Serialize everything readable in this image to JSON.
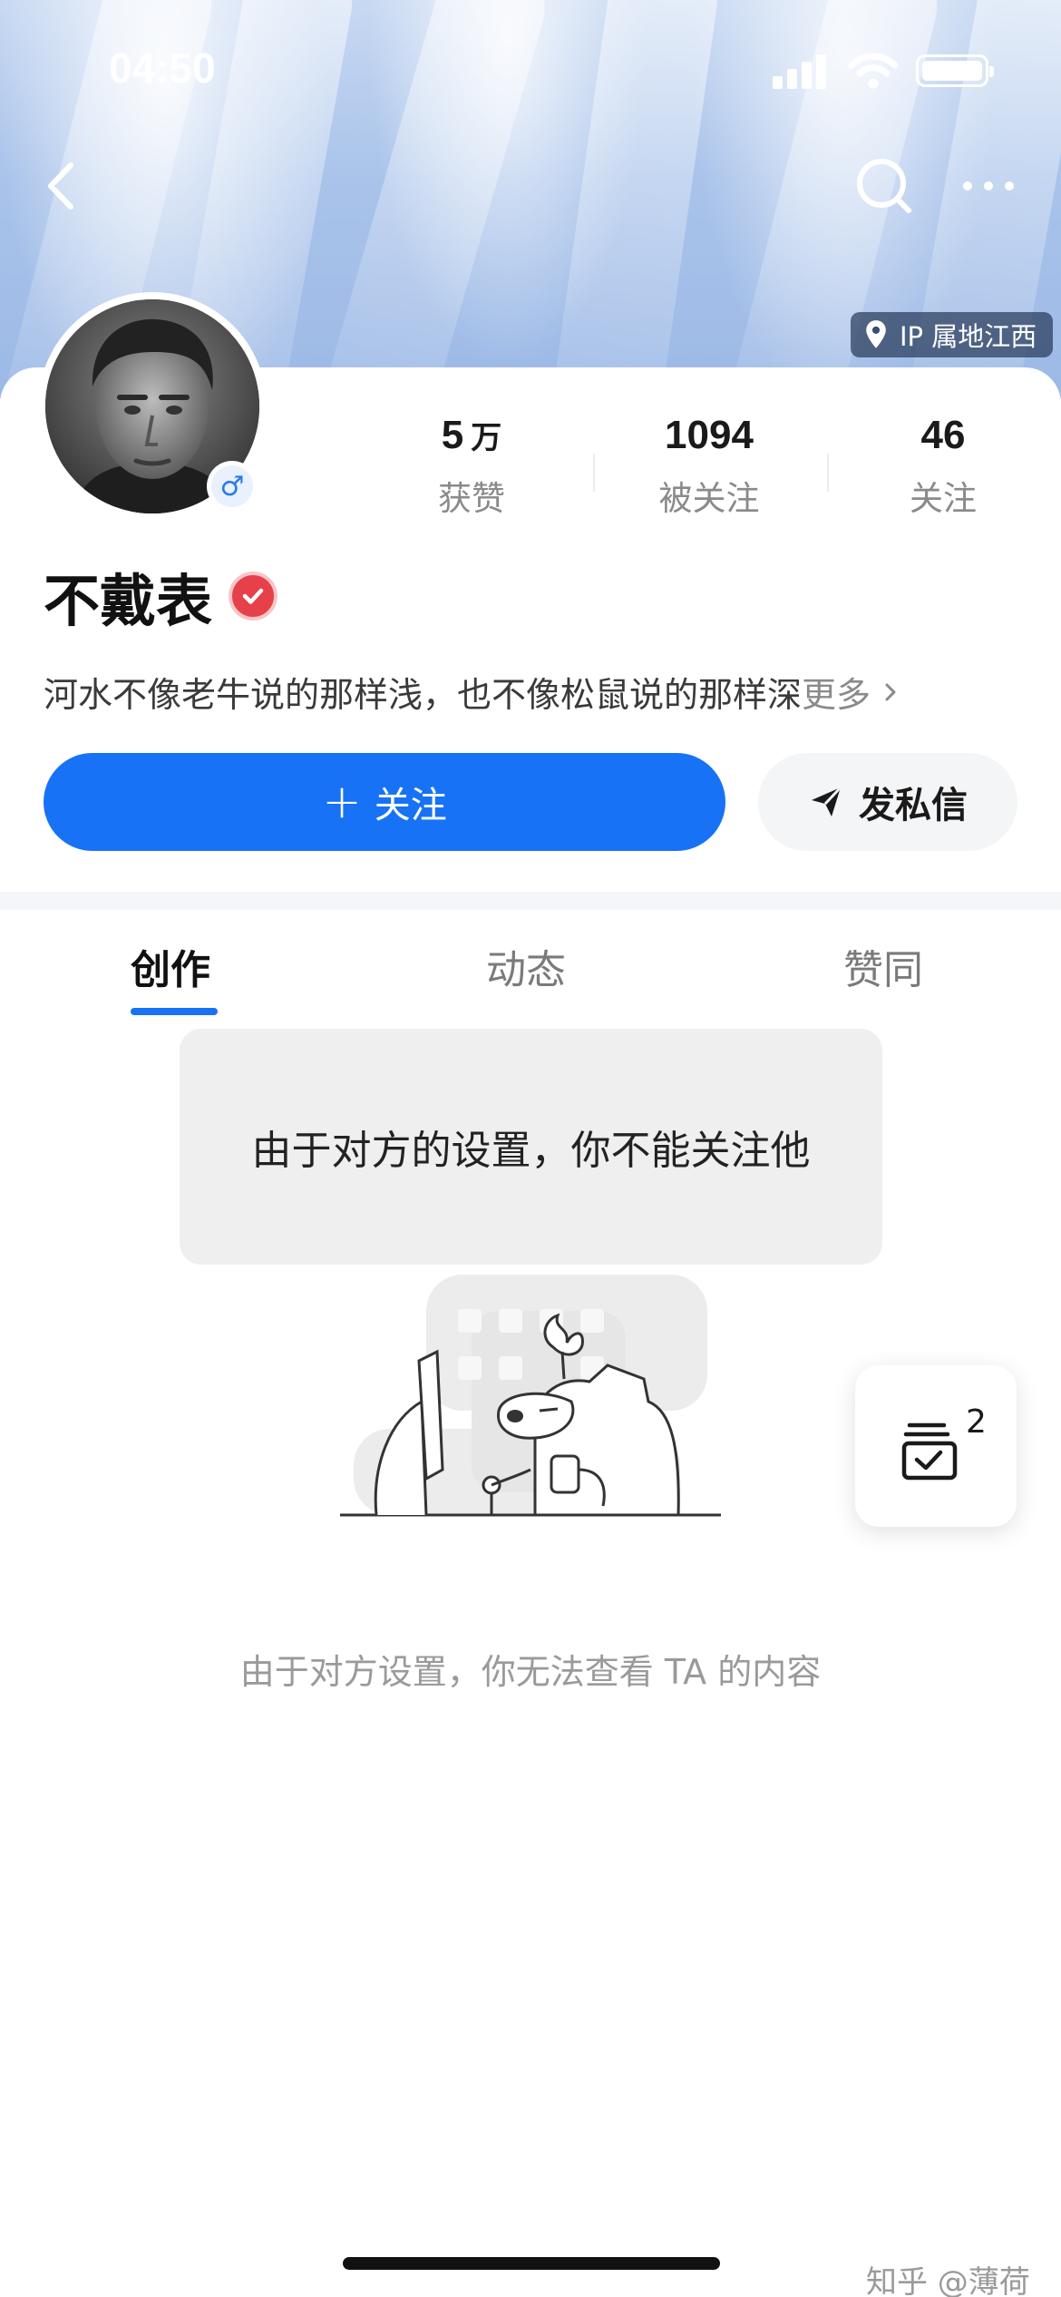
{
  "status_bar": {
    "time": "04:50"
  },
  "header": {
    "ip_location": "IP 属地江西"
  },
  "profile": {
    "name": "不戴表",
    "gender_symbol": "♂",
    "bio": "河水不像老牛说的那样浅，也不像松鼠说的那样深",
    "bio_more": "更多",
    "stats": [
      {
        "value": "5",
        "unit": "万",
        "label": "获赞"
      },
      {
        "value": "1094",
        "unit": "",
        "label": "被关注"
      },
      {
        "value": "46",
        "unit": "",
        "label": "关注"
      }
    ]
  },
  "actions": {
    "follow_plus": "+",
    "follow_label": "关注",
    "message_label": "发私信"
  },
  "tabs": [
    {
      "label": "创作",
      "active": true
    },
    {
      "label": "动态",
      "active": false
    },
    {
      "label": "赞同",
      "active": false
    }
  ],
  "toast": {
    "text": "由于对方的设置，你不能关注他"
  },
  "empty_state": {
    "text": "由于对方设置，你无法查看 TA 的内容"
  },
  "floating_button": {
    "badge": "2",
    "icon": "calendar-check-icon"
  },
  "watermark": "知乎 @薄荷",
  "colors": {
    "accent": "#1772f6",
    "verified": "#e6414a",
    "gender": "#2b7be8"
  }
}
